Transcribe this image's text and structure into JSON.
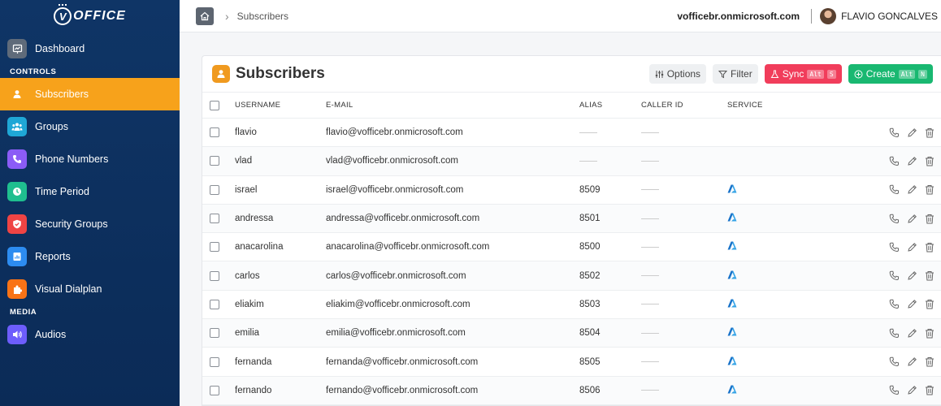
{
  "brand": {
    "logo_letter": "V",
    "logo_text": "OFFICE"
  },
  "sidebar": {
    "items": [
      {
        "label": "Dashboard",
        "icon": "chart-board-icon",
        "color": "#5f6b7a"
      },
      {
        "section": "CONTROLS"
      },
      {
        "label": "Subscribers",
        "icon": "user-icon",
        "color": "#f7a21b",
        "active": true
      },
      {
        "label": "Groups",
        "icon": "group-icon",
        "color": "#1fa7d6"
      },
      {
        "label": "Phone Numbers",
        "icon": "phone-icon",
        "color": "#8b5cf6"
      },
      {
        "label": "Time Period",
        "icon": "clock-icon",
        "color": "#1fbf8f"
      },
      {
        "label": "Security Groups",
        "icon": "shield-icon",
        "color": "#ef4444"
      },
      {
        "label": "Reports",
        "icon": "report-icon",
        "color": "#2d8cf0"
      },
      {
        "label": "Visual Dialplan",
        "icon": "puzzle-icon",
        "color": "#f97316"
      },
      {
        "section": "MEDIA"
      },
      {
        "label": "Audios",
        "icon": "speaker-icon",
        "color": "#6d5dfc"
      }
    ]
  },
  "topbar": {
    "breadcrumb": "Subscribers",
    "tenant": "vofficebr.onmicrosoft.com",
    "user_name": "FLAVIO GONCALVES"
  },
  "panel": {
    "title": "Subscribers",
    "options_label": "Options",
    "filter_label": "Filter",
    "sync_label": "Sync",
    "sync_kbd": [
      "Alt",
      "S"
    ],
    "create_label": "Create",
    "create_kbd": [
      "Alt",
      "N"
    ]
  },
  "table": {
    "headers": {
      "username": "USERNAME",
      "email": "E-MAIL",
      "alias": "ALIAS",
      "caller_id": "CALLER ID",
      "service": "SERVICE"
    },
    "rows": [
      {
        "username": "flavio",
        "email": "flavio@vofficebr.onmicrosoft.com",
        "alias": "",
        "service": false
      },
      {
        "username": "vlad",
        "email": "vlad@vofficebr.onmicrosoft.com",
        "alias": "",
        "service": false
      },
      {
        "username": "israel",
        "email": "israel@vofficebr.onmicrosoft.com",
        "alias": "8509",
        "service": true
      },
      {
        "username": "andressa",
        "email": "andressa@vofficebr.onmicrosoft.com",
        "alias": "8501",
        "service": true
      },
      {
        "username": "anacarolina",
        "email": "anacarolina@vofficebr.onmicrosoft.com",
        "alias": "8500",
        "service": true
      },
      {
        "username": "carlos",
        "email": "carlos@vofficebr.onmicrosoft.com",
        "alias": "8502",
        "service": true
      },
      {
        "username": "eliakim",
        "email": "eliakim@vofficebr.onmicrosoft.com",
        "alias": "8503",
        "service": true
      },
      {
        "username": "emilia",
        "email": "emilia@vofficebr.onmicrosoft.com",
        "alias": "8504",
        "service": true
      },
      {
        "username": "fernanda",
        "email": "fernanda@vofficebr.onmicrosoft.com",
        "alias": "8505",
        "service": true
      },
      {
        "username": "fernando",
        "email": "fernando@vofficebr.onmicrosoft.com",
        "alias": "8506",
        "service": true
      }
    ]
  }
}
